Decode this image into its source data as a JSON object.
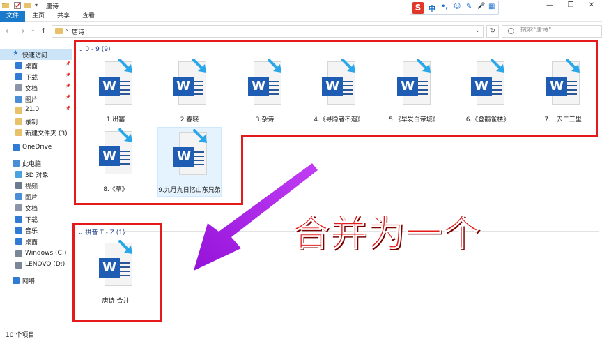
{
  "window": {
    "title": "唐诗",
    "minimize": "—",
    "restore": "❐",
    "close": "✕"
  },
  "ribbon": {
    "tabs": [
      {
        "label": "文件",
        "active": true
      },
      {
        "label": "主页",
        "active": false
      },
      {
        "label": "共享",
        "active": false
      },
      {
        "label": "查看",
        "active": false
      }
    ]
  },
  "ime": {
    "logo": "S",
    "items": [
      "中",
      "•,",
      "☺",
      "✎",
      "🎤",
      "▦"
    ]
  },
  "address": {
    "path": "唐诗",
    "separator": "›",
    "dropdown": "⌄",
    "refresh": "↻"
  },
  "search": {
    "placeholder": "搜索\"唐诗\""
  },
  "sidebar": {
    "items": [
      {
        "label": "快速访问",
        "icon": "star-icon",
        "color": "#2f7bd6",
        "selected": true,
        "pin": false
      },
      {
        "label": "桌面",
        "icon": "desktop-icon",
        "color": "#2f7bd6",
        "pin": true
      },
      {
        "label": "下载",
        "icon": "download-icon",
        "color": "#2f7bd6",
        "pin": true
      },
      {
        "label": "文档",
        "icon": "document-icon",
        "color": "#8a96a8",
        "pin": true
      },
      {
        "label": "图片",
        "icon": "picture-icon",
        "color": "#4a8fd6",
        "pin": true
      },
      {
        "label": "21.0",
        "icon": "folder-icon",
        "color": "#e8c26a",
        "pin": true
      },
      {
        "label": "录制",
        "icon": "folder-icon",
        "color": "#e8c26a",
        "pin": false
      },
      {
        "label": "新建文件夹 (3)",
        "icon": "folder-icon",
        "color": "#e8c26a",
        "pin": false
      },
      {
        "label": "OneDrive",
        "icon": "cloud-icon",
        "color": "#2f7bd6",
        "pin": false
      },
      {
        "label": "此电脑",
        "icon": "computer-icon",
        "color": "#4a8fd6",
        "pin": false
      },
      {
        "label": "3D 对象",
        "icon": "cube-icon",
        "color": "#4aa3e0",
        "pin": false
      },
      {
        "label": "视频",
        "icon": "video-icon",
        "color": "#6b7a8f",
        "pin": false
      },
      {
        "label": "图片",
        "icon": "picture-icon",
        "color": "#4a8fd6",
        "pin": false
      },
      {
        "label": "文档",
        "icon": "document-icon",
        "color": "#8a96a8",
        "pin": false
      },
      {
        "label": "下载",
        "icon": "download-icon",
        "color": "#2f7bd6",
        "pin": false
      },
      {
        "label": "音乐",
        "icon": "music-icon",
        "color": "#2f7bd6",
        "pin": false
      },
      {
        "label": "桌面",
        "icon": "desktop-icon",
        "color": "#2f7bd6",
        "pin": false
      },
      {
        "label": "Windows (C:)",
        "icon": "drive-icon",
        "color": "#7a8797",
        "pin": false
      },
      {
        "label": "LENOVO (D:)",
        "icon": "drive-icon",
        "color": "#7a8797",
        "pin": false
      },
      {
        "label": "网络",
        "icon": "network-icon",
        "color": "#2f7bd6",
        "pin": false
      }
    ]
  },
  "groups": [
    {
      "header": "0 - 9 (9)",
      "files": [
        "1.出塞",
        "2.春晓",
        "3.杂诗",
        "4.《寻隐者不遇》",
        "5.《早发白帝城》",
        "6.《登鹳雀楼》",
        "7.一去二三里",
        "8.《草》",
        "9.九月九日忆山东兄弟"
      ]
    },
    {
      "header": "拼音 T - Z (1)",
      "files": [
        "唐诗  合并"
      ]
    }
  ],
  "annotation": {
    "text": "合并为一个",
    "color": "#e51a1a",
    "arrow_color": "#a21ae0"
  },
  "status": {
    "text": "10 个项目"
  }
}
